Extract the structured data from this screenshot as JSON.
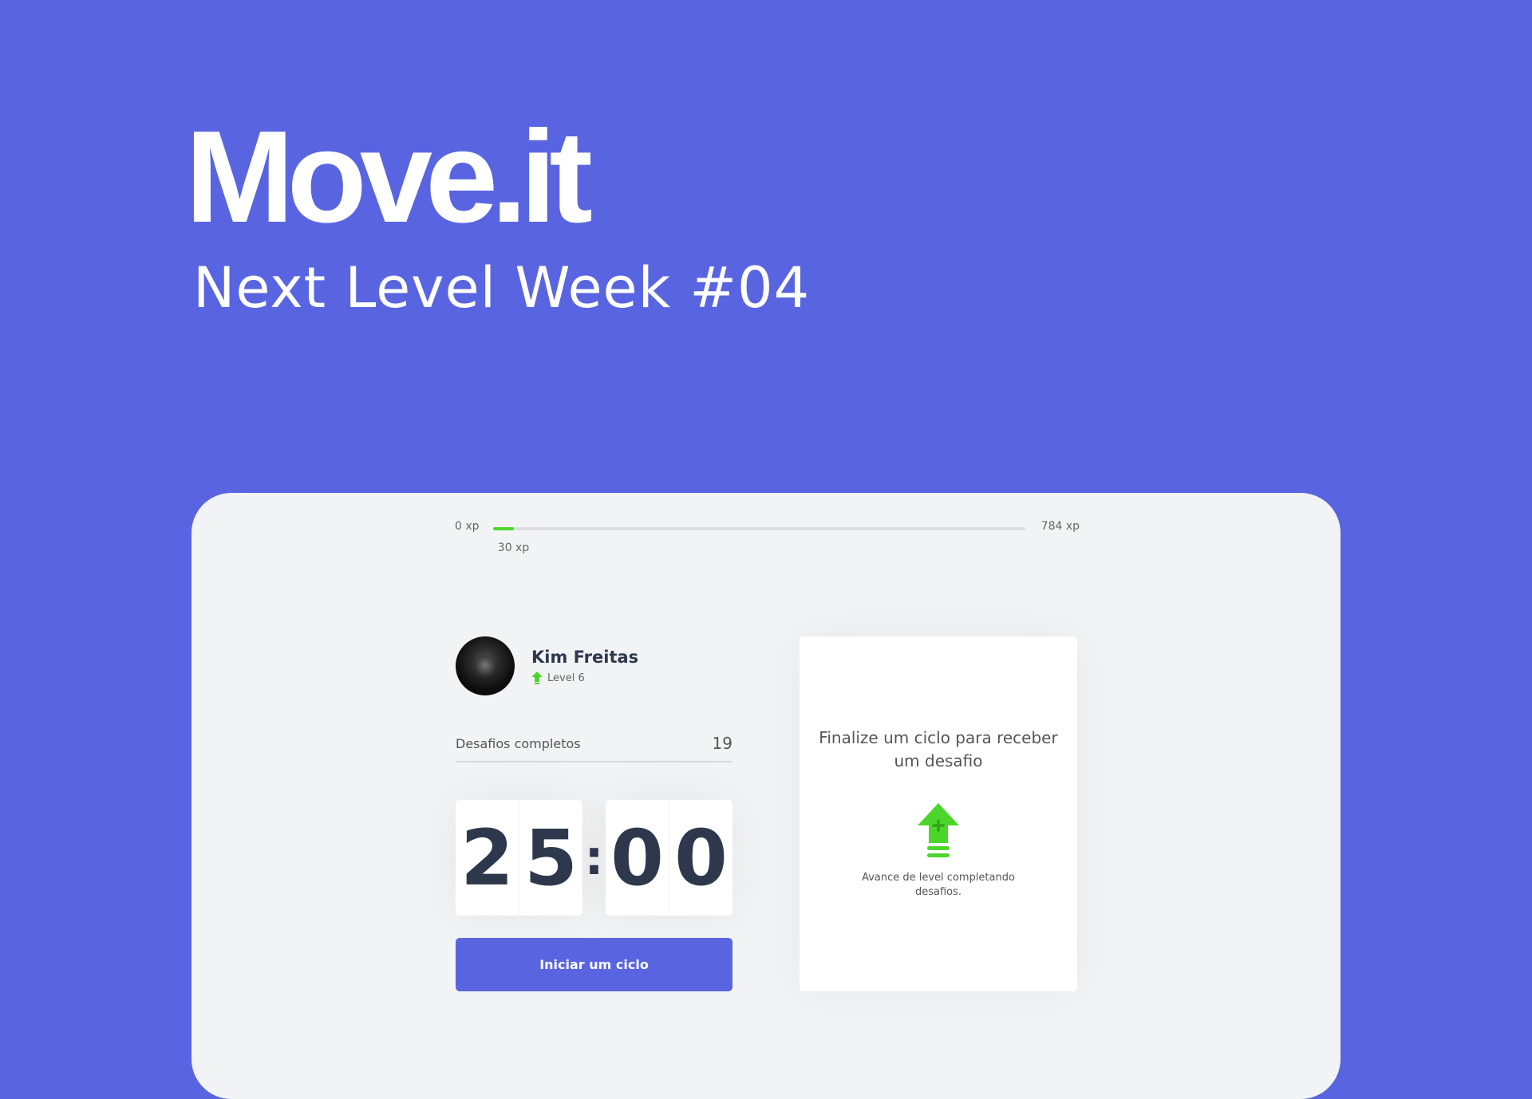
{
  "hero": {
    "title": "Move.it",
    "subtitle": "Next Level Week #04"
  },
  "xp": {
    "min_label": "0 xp",
    "max_label": "784 xp",
    "current_label": "30 xp",
    "current": 30,
    "max": 784
  },
  "profile": {
    "name": "Kim Freitas",
    "level_label": "Level 6"
  },
  "challenges_completed": {
    "label": "Desafios completos",
    "value": "19"
  },
  "countdown": {
    "minutes": [
      "2",
      "5"
    ],
    "separator": ":",
    "seconds": [
      "0",
      "0"
    ]
  },
  "start_button": {
    "label": "Iniciar um ciclo"
  },
  "challenge_box": {
    "title": "Finalize um ciclo para receber um desafio",
    "hint": "Avance de level completando desafios."
  },
  "colors": {
    "background": "#5965E0",
    "panel": "#F2F3F5",
    "accent_green": "#4CD62B",
    "primary_text": "#2E384D",
    "button": "#5965E0"
  },
  "icons": {
    "level": "level-up-arrow-icon",
    "challenge": "level-up-arrow-icon"
  }
}
